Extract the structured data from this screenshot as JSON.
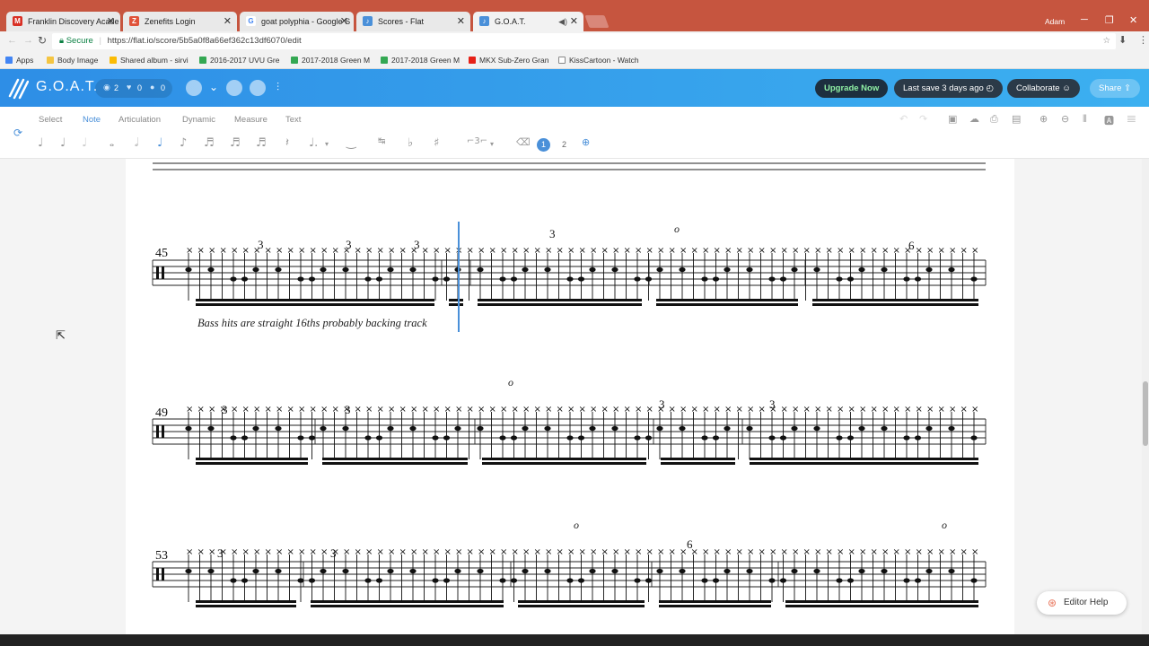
{
  "browser": {
    "tabs": [
      {
        "label": "Franklin Discovery Acade",
        "icon": "gmail-icon",
        "color": "#d93025"
      },
      {
        "label": "Zenefits Login",
        "icon": "zenefits-icon",
        "color": "#e0533a"
      },
      {
        "label": "goat polyphia - Google S",
        "icon": "google-icon",
        "color": "#4285f4"
      },
      {
        "label": "Scores - Flat",
        "icon": "flat-icon",
        "color": "#4a90d9"
      },
      {
        "label": "G.O.A.T.",
        "icon": "flat-icon",
        "color": "#4a90d9"
      }
    ],
    "user": "Adam",
    "secure_label": "Secure",
    "url": "https://flat.io/score/5b5a0f8a66ef362c13df6070/edit",
    "bookmarks": [
      "Apps",
      "Body Image",
      "Shared album - sirvi",
      "2016-2017 UVU Gre",
      "2017-2018 Green M",
      "2017-2018 Green M",
      "MKX Sub-Zero Gran",
      "KissCartoon - Watch"
    ]
  },
  "app": {
    "title": "G.O.A.T.",
    "views": "2",
    "likes": "0",
    "comments": "0",
    "upgrade": "Upgrade Now",
    "last_save": "Last save 3 days ago",
    "collaborate": "Collaborate",
    "share": "Share"
  },
  "toolbar": {
    "tabs": [
      "Select",
      "Note",
      "Articulation",
      "Dynamic",
      "Measure",
      "Text"
    ],
    "active_tab": "Note",
    "voice1": "1",
    "voice2": "2"
  },
  "score": {
    "measure_numbers": [
      "45",
      "49",
      "53"
    ],
    "annotation": "Bass hits are straight 16ths probably backing track",
    "dynamics": [
      "o",
      "o",
      "o",
      "o"
    ],
    "tuplets": [
      "3",
      "3",
      "3",
      "3",
      "6",
      "3",
      "3",
      "3",
      "3",
      "3",
      "3",
      "6"
    ]
  },
  "help": {
    "label": "Editor Help"
  }
}
